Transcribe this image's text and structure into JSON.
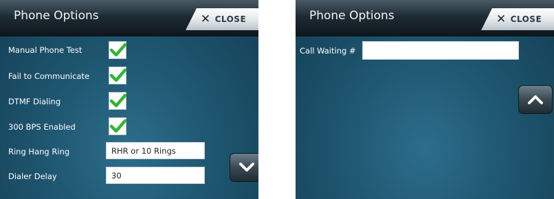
{
  "left_panel": {
    "title": "Phone Options",
    "close_label": "CLOSE",
    "options": [
      {
        "label": "Manual Phone Test",
        "checked": true
      },
      {
        "label": "Fail to Communicate",
        "checked": true
      },
      {
        "label": "DTMF Dialing",
        "checked": true
      },
      {
        "label": "300 BPS Enabled",
        "checked": true
      }
    ],
    "fields": [
      {
        "label": "Ring Hang Ring",
        "value": "RHR or 10 Rings"
      },
      {
        "label": "Dialer Delay",
        "value": "30"
      }
    ],
    "nav_icon": "chevron-down-icon"
  },
  "right_panel": {
    "title": "Phone Options",
    "close_label": "CLOSE",
    "fields": [
      {
        "label": "Call Waiting #",
        "value": ""
      }
    ],
    "nav_icon": "chevron-up-icon"
  },
  "colors": {
    "check": "#33b534",
    "background": "#1f5670",
    "titlebar": "#1f2c35"
  }
}
